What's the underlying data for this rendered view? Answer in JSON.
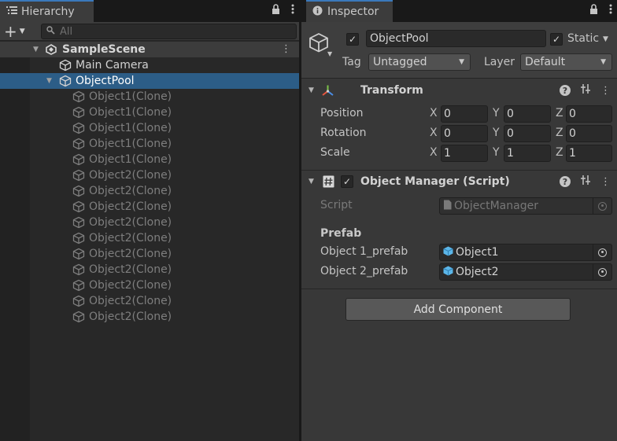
{
  "hierarchy": {
    "tab_label": "Hierarchy",
    "search_placeholder": "All",
    "scene_name": "SampleScene",
    "items": [
      {
        "label": "Main Camera",
        "kind": "go"
      },
      {
        "label": "ObjectPool",
        "kind": "selected"
      },
      {
        "label": "Object1(Clone)",
        "kind": "clone"
      },
      {
        "label": "Object1(Clone)",
        "kind": "clone"
      },
      {
        "label": "Object1(Clone)",
        "kind": "clone"
      },
      {
        "label": "Object1(Clone)",
        "kind": "clone"
      },
      {
        "label": "Object1(Clone)",
        "kind": "clone"
      },
      {
        "label": "Object2(Clone)",
        "kind": "clone"
      },
      {
        "label": "Object2(Clone)",
        "kind": "clone"
      },
      {
        "label": "Object2(Clone)",
        "kind": "clone"
      },
      {
        "label": "Object2(Clone)",
        "kind": "clone"
      },
      {
        "label": "Object2(Clone)",
        "kind": "clone"
      },
      {
        "label": "Object2(Clone)",
        "kind": "clone"
      },
      {
        "label": "Object2(Clone)",
        "kind": "clone"
      },
      {
        "label": "Object2(Clone)",
        "kind": "clone"
      },
      {
        "label": "Object2(Clone)",
        "kind": "clone"
      },
      {
        "label": "Object2(Clone)",
        "kind": "clone"
      }
    ]
  },
  "inspector": {
    "tab_label": "Inspector",
    "object_name": "ObjectPool",
    "static_label": "Static",
    "tag_label": "Tag",
    "tag_value": "Untagged",
    "layer_label": "Layer",
    "layer_value": "Default",
    "transform": {
      "title": "Transform",
      "rows": [
        {
          "label": "Position",
          "x": "0",
          "y": "0",
          "z": "0"
        },
        {
          "label": "Rotation",
          "x": "0",
          "y": "0",
          "z": "0"
        },
        {
          "label": "Scale",
          "x": "1",
          "y": "1",
          "z": "1"
        }
      ],
      "axes": {
        "x": "X",
        "y": "Y",
        "z": "Z"
      }
    },
    "script_component": {
      "title": "Object Manager (Script)",
      "script_label": "Script",
      "script_value": "ObjectManager",
      "section_label": "Prefab",
      "fields": [
        {
          "label": "Object 1_prefab",
          "value": "Object1"
        },
        {
          "label": "Object 2_prefab",
          "value": "Object2"
        }
      ]
    },
    "add_component_label": "Add Component"
  },
  "colors": {
    "selection": "#2c5d87",
    "tab_accent": "#3a79bb",
    "prefab_blue": "#5bb6e9"
  }
}
